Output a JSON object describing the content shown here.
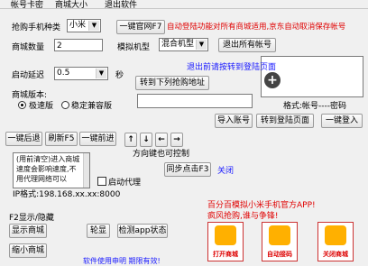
{
  "tabs": [
    "帐号卡密",
    "商城大小",
    "退出软件"
  ],
  "phone_kind_label": "抢购手机种类",
  "phone_kind_value": "小米",
  "one_key_official_button": "一键官网F7",
  "auto_login_notice": "自动登陆功能对所有商城适用,京东自动取消保存帐号",
  "mall_count_label": "商城数量",
  "mall_count_value": "2",
  "model_label": "模拟机型",
  "model_value": "混合机型",
  "exit_all_accounts_button": "退出所有帐号",
  "exit_to_login_notice": "退出前请按转到登陆页面",
  "startup_delay_label": "启动延迟",
  "startup_delay_value": "0.5",
  "seconds_unit": "秒",
  "goto_buy_address_button": "转到下列抢购地址",
  "mall_version_label": "商城版本:",
  "version_options": [
    "极速版",
    "稳定兼容版"
  ],
  "format_hint": "格式:帐号----密码",
  "import_account_button": "导入账号",
  "goto_login_page_button": "转到登陆页面",
  "one_key_login_button": "一键登入",
  "nav_back_button": "一键后退",
  "refresh_button": "刷新F5",
  "nav_forward_button": "一键前进",
  "arrow_up": "↑",
  "arrow_down": "↓",
  "arrow_left": "←",
  "arrow_right": "→",
  "direction_hint": "方向键也可控制",
  "notice_text": "(用前清空)进入商城速度会影响速度,不用代理网络可以",
  "start_proxy_label": "启动代理",
  "sync_click_button": "同步点击F3",
  "close_link": "关闭",
  "ip_text": "IP格式:198.168.xx.xx:8000",
  "f2_toggle_label": "F2显示/隐藏",
  "show_mall_button": "显示商城",
  "lunxian_button": "轮显",
  "check_app_status_button": "检测app状态",
  "shrink_mall_button": "缩小商城",
  "promo_line1": "百分百模拟小米手机官方APP!",
  "promo_line2": "疯风抢购,谁与争锋!",
  "shops": [
    "打开商城",
    "自动接码",
    "关闭商城"
  ],
  "footer_text": "软件使用申明 期限有效!",
  "colors": {
    "red": "#e00000",
    "blue": "#1a1aff"
  }
}
